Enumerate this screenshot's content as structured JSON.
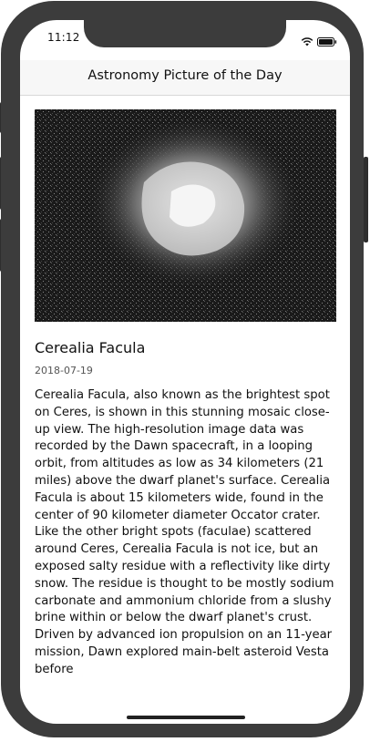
{
  "status_bar": {
    "time": "11:12",
    "icons": [
      "wifi-icon",
      "battery-icon"
    ]
  },
  "nav": {
    "title": "Astronomy Picture of the Day"
  },
  "apod": {
    "image_alt": "Cerealia Facula close-up",
    "title": "Cerealia Facula",
    "date": "2018-07-19",
    "explanation": "Cerealia Facula, also known as the brightest spot on Ceres, is shown in this stunning mosaic close-up view. The high-resolution image data was recorded by the Dawn spacecraft, in a looping orbit, from altitudes as low as 34 kilometers (21 miles) above the dwarf planet's surface. Cerealia Facula is about 15 kilometers wide, found in the center of 90 kilometer diameter Occator crater. Like the other bright spots (faculae) scattered around Ceres, Cerealia Facula is not ice, but an exposed salty residue with a reflectivity like dirty snow. The residue is thought to be mostly sodium carbonate and ammonium chloride from a slushy brine within or below the dwarf planet's crust. Driven by advanced ion propulsion on an 11-year mission, Dawn explored main-belt asteroid Vesta before"
  },
  "colors": {
    "frame": "#3c3c3c",
    "navbar_bg": "#f7f7f7",
    "image_bg": "#1a1a1a"
  }
}
